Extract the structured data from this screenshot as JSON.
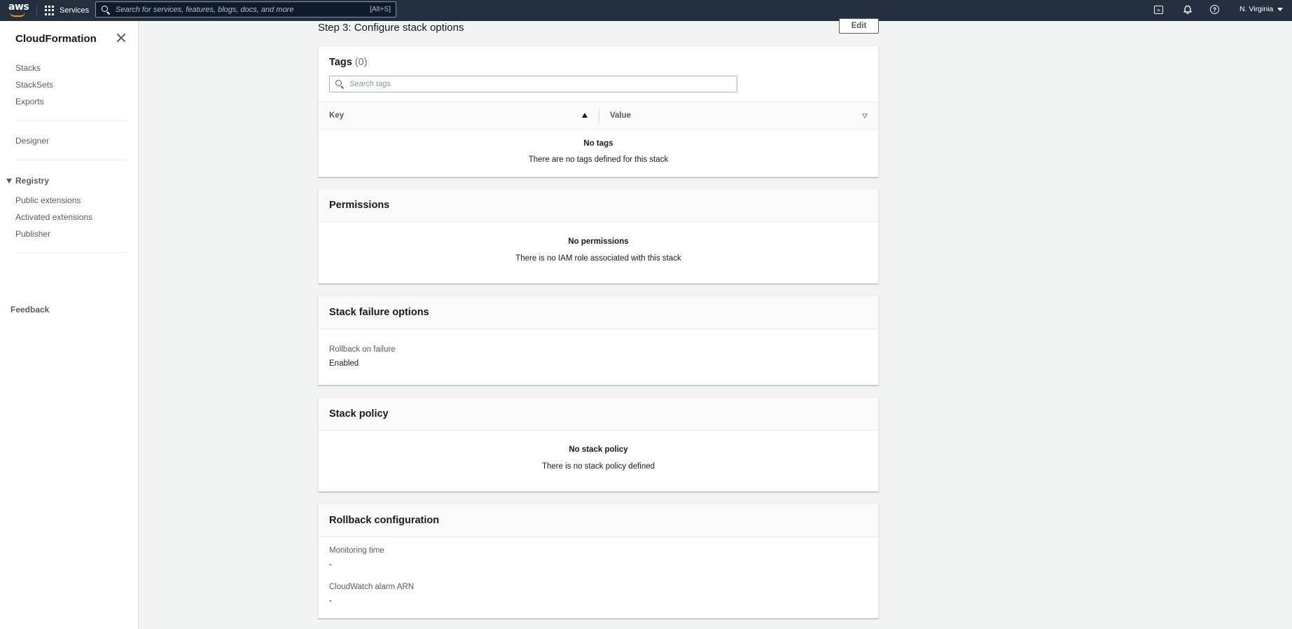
{
  "topnav": {
    "logo": "aws",
    "services_label": "Services",
    "search_placeholder": "Search for services, features, blogs, docs, and more",
    "search_shortcut": "[Alt+S]",
    "region": "N. Virginia"
  },
  "sidebar": {
    "title": "CloudFormation",
    "group1": [
      "Stacks",
      "StackSets",
      "Exports"
    ],
    "designer": "Designer",
    "registry": {
      "label": "Registry",
      "items": [
        "Public extensions",
        "Activated extensions",
        "Publisher"
      ]
    },
    "feedback": "Feedback"
  },
  "main": {
    "step_title": "Step 3: Configure stack options",
    "edit_label": "Edit",
    "tags": {
      "title": "Tags",
      "count": "(0)",
      "search_placeholder": "Search tags",
      "col_key": "Key",
      "col_value": "Value",
      "empty_title": "No tags",
      "empty_text": "There are no tags defined for this stack"
    },
    "permissions": {
      "title": "Permissions",
      "empty_title": "No permissions",
      "empty_text": "There is no IAM role associated with this stack"
    },
    "failure": {
      "title": "Stack failure options",
      "label": "Rollback on failure",
      "value": "Enabled"
    },
    "policy": {
      "title": "Stack policy",
      "empty_title": "No stack policy",
      "empty_text": "There is no stack policy defined"
    },
    "rollback": {
      "title": "Rollback configuration",
      "monitoring_label": "Monitoring time",
      "monitoring_value": "-",
      "alarm_label": "CloudWatch alarm ARN",
      "alarm_value": "-"
    }
  }
}
